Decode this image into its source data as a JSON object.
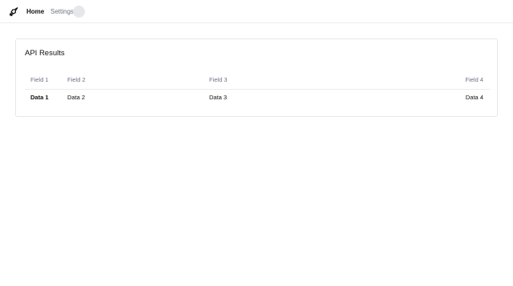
{
  "nav": {
    "logo_icon": "rocket-icon",
    "home_label": "Home",
    "settings_label": "Settings"
  },
  "card": {
    "title": "API Results",
    "columns": [
      "Field 1",
      "Field 2",
      "Field 3",
      "Field 4"
    ],
    "rows": [
      [
        "Data 1",
        "Data 2",
        "Data 3",
        "Data 4"
      ]
    ]
  },
  "colors": {
    "border": "#e5e7eb",
    "muted_text": "#6b7280",
    "text": "#111111",
    "avatar": "#e5e7eb"
  }
}
